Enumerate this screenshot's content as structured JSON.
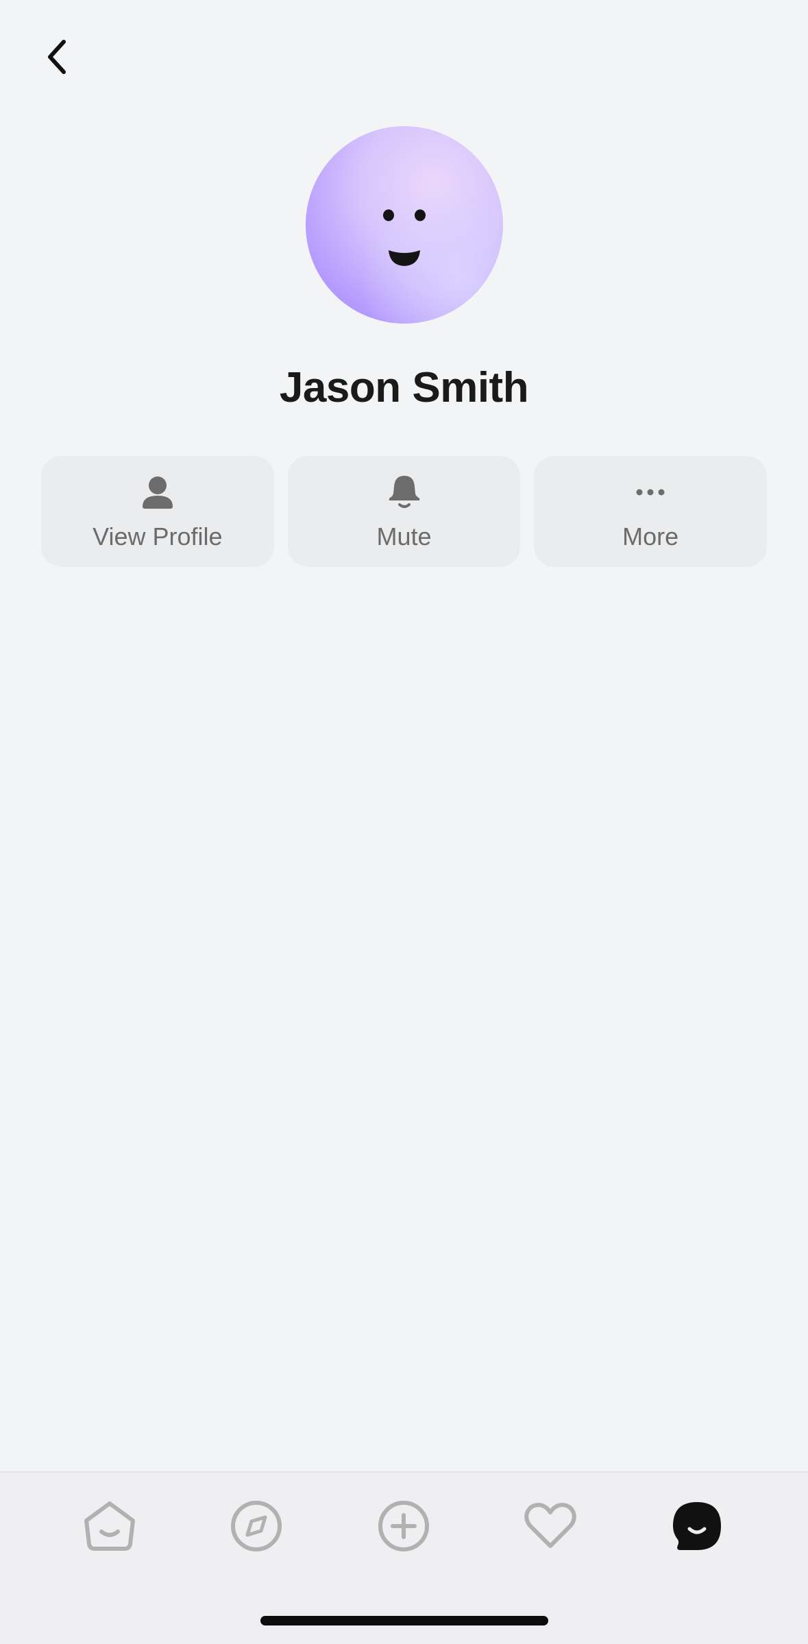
{
  "header": {
    "back_icon": "chevron-left-icon"
  },
  "profile": {
    "name": "Jason Smith",
    "avatar_icon": "smiley-face-avatar",
    "avatar_color": "#c4b3ff"
  },
  "actions": [
    {
      "label": "View Profile",
      "icon": "person-icon"
    },
    {
      "label": "Mute",
      "icon": "bell-icon"
    },
    {
      "label": "More",
      "icon": "ellipsis-icon"
    }
  ],
  "tabbar": {
    "items": [
      {
        "icon": "home-icon",
        "active": false
      },
      {
        "icon": "compass-icon",
        "active": false
      },
      {
        "icon": "plus-circle-icon",
        "active": false
      },
      {
        "icon": "heart-icon",
        "active": false
      },
      {
        "icon": "chat-bubble-icon",
        "active": true
      }
    ],
    "active_color": "#111111",
    "inactive_color": "#b1b1b1"
  }
}
